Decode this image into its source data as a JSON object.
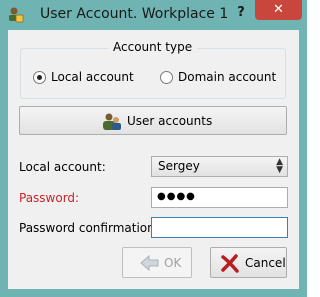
{
  "window": {
    "title": "User Account. Workplace 1",
    "help_label": "?",
    "close_label": "✕"
  },
  "account_type": {
    "title": "Account type",
    "options": [
      {
        "label": "Local account",
        "checked": true
      },
      {
        "label": "Domain account",
        "checked": false
      }
    ]
  },
  "user_accounts_button": {
    "label": "User accounts",
    "icon": "users-icon"
  },
  "form": {
    "local_account_label": "Local account:",
    "local_account_value": "Sergey",
    "password_label": "Password:",
    "password_value": "●●●●",
    "confirm_label": "Password confirmation:",
    "confirm_value": ""
  },
  "buttons": {
    "ok_label": "OK",
    "cancel_label": "Cancel"
  },
  "colors": {
    "titlebar": "#6fb3b3",
    "close": "#c9463d",
    "password_label": "#c8242b"
  }
}
